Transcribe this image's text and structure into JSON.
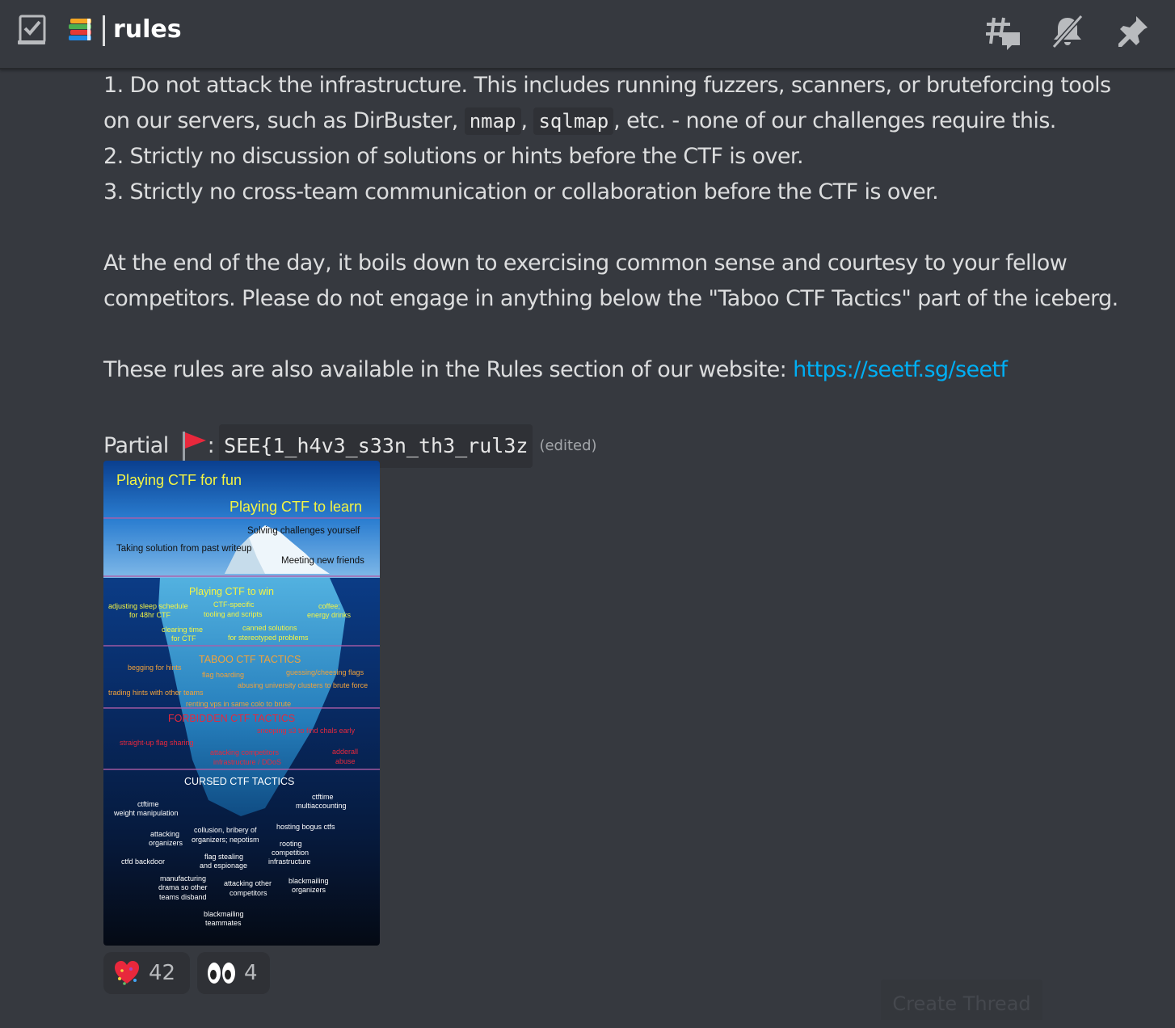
{
  "header": {
    "channel_name": "rules",
    "left_icon": "checkbox-icon",
    "channel_emoji": "books-emoji-icon",
    "right_icons": [
      "threads-icon",
      "notifications-muted-icon",
      "pin-icon"
    ]
  },
  "message": {
    "rule1_line1": "1. Do not attack the infrastructure. This includes running fuzzers, scanners, or bruteforcing tools",
    "rule1_line2_prefix": "on our servers, such as DirBuster, ",
    "code_nmap": "nmap",
    "comma": ", ",
    "code_sqlmap": "sqlmap",
    "rule1_line2_suffix": ", etc. - none of our challenges require this.",
    "rule2": "2. Strictly no discussion of solutions or hints before the CTF is over.",
    "rule3": "3. Strictly no cross-team communication or collaboration before the CTF is over.",
    "para1_line1": "At the end of the day, it boils down to exercising common sense and courtesy to your fellow",
    "para1_line2": "competitors. Please do not engage in anything below the \"Taboo CTF Tactics\" part of the iceberg.",
    "para2_prefix": "These rules are also available in the Rules section of our website: ",
    "website_link": "https://seetf.sg/seetf",
    "partial_label": "Partial",
    "partial_colon": ":",
    "flag_code": "SEE{1_h4v3_s33n_th3_rul3z",
    "edited": "(edited)"
  },
  "iceberg": {
    "title_fun": "Playing CTF for fun",
    "title_learn": "Playing CTF to learn",
    "solving": "Solving challenges yourself",
    "taking": "Taking solution from past writeup",
    "meeting": "Meeting new friends",
    "win": "Playing CTF to win",
    "sleep1": "adjusting sleep schedule",
    "sleep2": "for 48hr CTF",
    "specific1": "CTF-specific",
    "specific2": "tooling and scripts",
    "coffee1": "coffee;",
    "coffee2": "energy drinks",
    "clearing1": "clearing time",
    "clearing2": "for CTF",
    "canned1": "canned solutions",
    "canned2": "for stereotyped problems",
    "taboo": "TABOO CTF TACTICS",
    "begging": "begging for hints",
    "hoarding": "flag hoarding",
    "guessing": "guessing/cheesing flags",
    "abusing": "abusing university clusters to brute force",
    "trading": "trading hints with other teams",
    "renting": "renting vps in same colo to brute",
    "forbidden": "FORBIDDEN CTF TACTICS",
    "snooping": "snooping s3 to find chals early",
    "straight": "straight-up flag sharing",
    "attacking_comp1": "attacking competitors",
    "attacking_comp2": "infrastructure / DDoS",
    "adderall1": "adderall",
    "adderall2": "abuse",
    "cursed": "CURSED CTF TACTICS",
    "ctftime_weight1": "ctftime",
    "ctftime_weight2": "weight manipulation",
    "ctftime_multi1": "ctftime",
    "ctftime_multi2": "multiaccounting",
    "attacking_org1": "attacking",
    "attacking_org2": "organizers",
    "collusion1": "collusion, bribery of",
    "collusion2": "organizers; nepotism",
    "hosting": "hosting bogus ctfs",
    "rooting1": "rooting",
    "rooting2": "competition",
    "rooting3": "infrastructure",
    "backdoor": "ctfd backdoor",
    "stealing1": "flag stealing",
    "stealing2": "and espionage",
    "drama1": "manufacturing",
    "drama2": "drama so other",
    "drama3": "teams disband",
    "attacking_other1": "attacking other",
    "attacking_other2": "competitors",
    "blackmail_org1": "blackmailing",
    "blackmail_org2": "organizers",
    "blackmail_team1": "blackmailing",
    "blackmail_team2": "teammates"
  },
  "reactions": [
    {
      "emoji": "heart-party-emoji-icon",
      "count": "42"
    },
    {
      "emoji": "eyes-emoji-icon",
      "count": "4"
    }
  ],
  "create_thread": "Create Thread",
  "colors": {
    "background": "#36393f",
    "text": "#dcddde",
    "link": "#00aff4",
    "code_bg": "#2f3136"
  }
}
